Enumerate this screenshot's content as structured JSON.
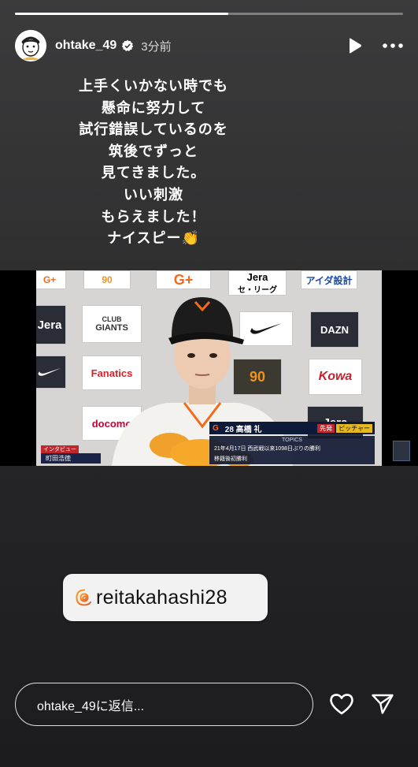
{
  "story": {
    "progress_fraction": 0.55,
    "username": "ohtake_49",
    "time_ago": "3分前",
    "verified_icon": "verified-badge-icon",
    "caption_lines": [
      "上手くいかない時でも",
      "懸命に努力して",
      "試行錯誤しているのを",
      "筑後でずっと",
      "見てきました。",
      "いい刺激",
      "もらえました！",
      "ナイスピー👏"
    ]
  },
  "media": {
    "sponsors": {
      "giants": "GIANTS",
      "club": "CLUB",
      "nike": "✓",
      "dazn": "DAZN",
      "fanatics": "Fanatics",
      "kowa": "Kowa",
      "docomo": "docomo",
      "jera": "Jera",
      "jera_sub": "セ・リーグ",
      "aida": "アイダ設計",
      "g_plus": "G+",
      "jera2": "Jera"
    },
    "overlay": {
      "player_number_name": "28 高橋 礼",
      "tag_team": "先発",
      "tag_role": "ピッチャー",
      "topics_label": "TOPICS",
      "topics_line1": "21年4月17日 西武戦以来1098日ぶりの勝利",
      "topics_line2": "移籍後初勝利",
      "interview_label": "インタビュー",
      "interviewer": "町田浩徳"
    }
  },
  "mention": {
    "handle": "reitakahashi28"
  },
  "footer": {
    "reply_placeholder": "ohtake_49に返信..."
  },
  "colors": {
    "accent_orange": "#f0931e",
    "giants_orange": "#f26b1d"
  }
}
